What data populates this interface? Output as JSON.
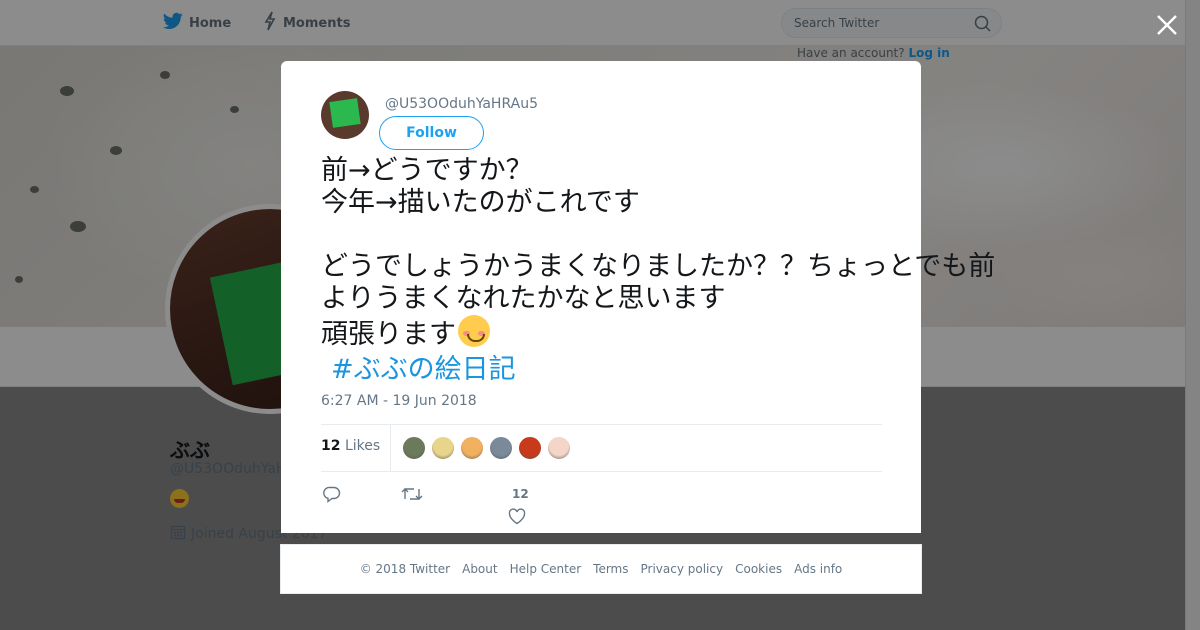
{
  "topbar": {
    "nav": [
      {
        "label": "Home",
        "icon": "twitter-bird-icon"
      },
      {
        "label": "Moments",
        "icon": "lightning-icon"
      }
    ],
    "search_placeholder": "Search Twitter",
    "login_prompt": "Have an account?",
    "login_link": "Log in"
  },
  "profile": {
    "name": "ぶぶ",
    "handle": "@U53OOduhYaHRAu5",
    "joined": "Joined August 2017"
  },
  "tweet": {
    "handle": "@U53OOduhYaHRAu5",
    "follow_label": "Follow",
    "text": "前→どうですか？\n今年→描いたのがこれです\n\nどうでしょうかうまくなりましたか？？ちょっとでも前よりうまくなれたかなと思います",
    "text_tail": "頑張ります",
    "hashtag": "#ぶぶの絵日記",
    "timestamp": "6:27 AM - 19 Jun 2018",
    "likes_count": "12",
    "likes_label": "Likes",
    "like_action_count": "12",
    "likers": [
      {
        "color": "#6a7a5a"
      },
      {
        "color": "#e8d48a"
      },
      {
        "color": "#f0b060"
      },
      {
        "color": "#7a8a9a"
      },
      {
        "color": "#c83a1a"
      },
      {
        "color": "#f3d6c8"
      }
    ]
  },
  "footer": {
    "links": [
      "© 2018 Twitter",
      "About",
      "Help Center",
      "Terms",
      "Privacy policy",
      "Cookies",
      "Ads info"
    ]
  },
  "colors": {
    "accent": "#1da1f2",
    "hashtag": "#1b95e0",
    "muted": "#657786"
  }
}
